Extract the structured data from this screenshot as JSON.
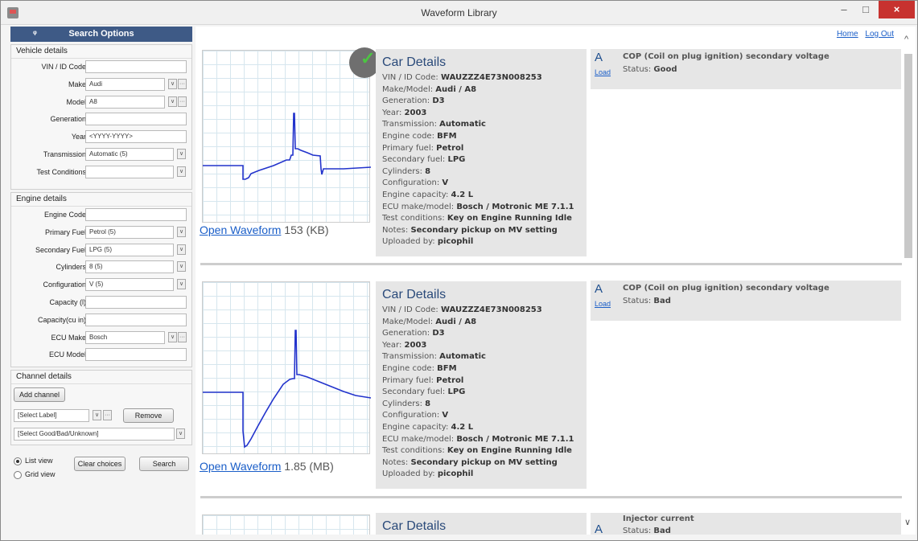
{
  "window": {
    "title": "Waveform Library",
    "min_icon": "minimize-icon",
    "max_icon": "maximize-icon",
    "close_icon": "close-icon",
    "min_glyph": "–",
    "max_glyph": "□",
    "close_glyph": "×"
  },
  "sidebar": {
    "header": "Search Options",
    "pin_glyph": "ᵠ",
    "vehicle": {
      "title": "Vehicle details",
      "vin_label": "VIN / ID Code",
      "vin_value": "",
      "make_label": "Make",
      "make_value": "Audi",
      "model_label": "Model",
      "model_value": "A8",
      "gen_label": "Generation",
      "gen_value": "",
      "year_label": "Year",
      "year_placeholder": "<YYYY-YYYY>",
      "trans_label": "Transmission",
      "trans_value": "Automatic (5)",
      "test_label": "Test Conditions",
      "test_value": ""
    },
    "engine": {
      "title": "Engine details",
      "code_label": "Engine Code",
      "code_value": "",
      "pf_label": "Primary Fuel",
      "pf_value": "Petrol (5)",
      "sf_label": "Secondary Fuel",
      "sf_value": "LPG (5)",
      "cyl_label": "Cylinders",
      "cyl_value": "8 (5)",
      "conf_label": "Configuration",
      "conf_value": "V (5)",
      "capl_label": "Capacity (l)",
      "capl_value": "",
      "capc_label": "Capacity(cu in)",
      "capc_value": "",
      "ecu_label": "ECU Make",
      "ecu_value": "Bosch",
      "ecum_label": "ECU Model",
      "ecum_value": ""
    },
    "channel": {
      "title": "Channel details",
      "add_label": "Add channel",
      "label_select": "[Select Label]",
      "remove_label": "Remove",
      "gbu_select": "[Select Good/Bad/Unknown]"
    },
    "views": {
      "list": "List view",
      "grid": "Grid view",
      "list_selected": true,
      "clear_label": "Clear choices",
      "search_label": "Search"
    },
    "icons": {
      "dropdown": "chevron-down-icon",
      "more": "ellipsis-icon"
    },
    "glyphs": {
      "dropdown": "∨",
      "more": "···"
    }
  },
  "top_links": {
    "home": "Home",
    "logout": "Log Out"
  },
  "results": [
    {
      "verified": true,
      "verified_glyph": "✓",
      "open_label": "Open Waveform",
      "size": "153 (KB)",
      "details_title": "Car Details",
      "details": [
        {
          "k": "VIN / ID Code: ",
          "v": "WAUZZZ4E73N008253"
        },
        {
          "k": "Make/Model: ",
          "v": "Audi / A8"
        },
        {
          "k": "Generation: ",
          "v": "D3"
        },
        {
          "k": "Year: ",
          "v": "2003"
        },
        {
          "k": "Transmission: ",
          "v": "Automatic"
        },
        {
          "k": "Engine code: ",
          "v": "BFM"
        },
        {
          "k": "Primary fuel: ",
          "v": "Petrol"
        },
        {
          "k": "Secondary fuel: ",
          "v": "LPG"
        },
        {
          "k": "Cylinders: ",
          "v": "8"
        },
        {
          "k": "Configuration: ",
          "v": "V"
        },
        {
          "k": "Engine capacity: ",
          "v": "4.2 L"
        },
        {
          "k": "ECU make/model: ",
          "v": "Bosch / Motronic ME 7.1.1"
        },
        {
          "k": "Test conditions: ",
          "v": "Key on Engine Running Idle"
        },
        {
          "k": "Notes: ",
          "v": "Secondary pickup on MV setting"
        },
        {
          "k": "Uploaded by: ",
          "v": "picophil"
        }
      ],
      "channel": {
        "letter": "A",
        "load": "Load",
        "title": "COP (Coil on plug ignition) secondary voltage",
        "status_label": "Status: ",
        "status": "Good"
      }
    },
    {
      "verified": false,
      "open_label": "Open Waveform",
      "size": "1.85 (MB)",
      "details_title": "Car Details",
      "details": [
        {
          "k": "VIN / ID Code: ",
          "v": "WAUZZZ4E73N008253"
        },
        {
          "k": "Make/Model: ",
          "v": "Audi / A8"
        },
        {
          "k": "Generation: ",
          "v": "D3"
        },
        {
          "k": "Year: ",
          "v": "2003"
        },
        {
          "k": "Transmission: ",
          "v": "Automatic"
        },
        {
          "k": "Engine code: ",
          "v": "BFM"
        },
        {
          "k": "Primary fuel: ",
          "v": "Petrol"
        },
        {
          "k": "Secondary fuel: ",
          "v": "LPG"
        },
        {
          "k": "Cylinders: ",
          "v": "8"
        },
        {
          "k": "Configuration: ",
          "v": "V"
        },
        {
          "k": "Engine capacity: ",
          "v": "4.2 L"
        },
        {
          "k": "ECU make/model: ",
          "v": "Bosch / Motronic ME 7.1.1"
        },
        {
          "k": "Test conditions: ",
          "v": "Key on Engine Running Idle"
        },
        {
          "k": "Notes: ",
          "v": "Secondary pickup on MV setting"
        },
        {
          "k": "Uploaded by: ",
          "v": "picophil"
        }
      ],
      "channel": {
        "letter": "A",
        "load": "Load",
        "title": "COP (Coil on plug ignition) secondary voltage",
        "status_label": "Status: ",
        "status": "Bad"
      }
    },
    {
      "verified": false,
      "details_title": "Car Details",
      "channel": {
        "letter": "A",
        "title": "Injector current",
        "status_label": "Status: ",
        "status": "Bad"
      }
    }
  ],
  "scroll": {
    "up_glyph": "^",
    "down_glyph": "∨"
  },
  "colors": {
    "accent": "#3e5a86",
    "link": "#1a5ec8",
    "close": "#c7322f",
    "check": "#4cc542",
    "waveform": "#2233cc"
  }
}
